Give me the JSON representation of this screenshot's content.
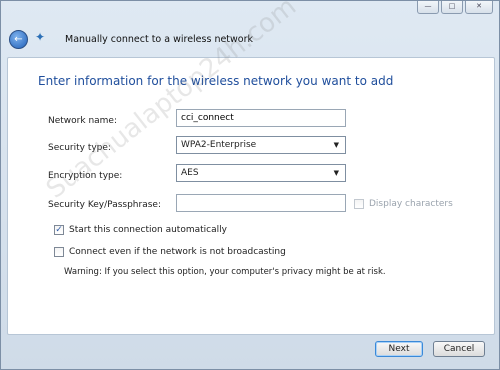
{
  "window": {
    "title": "Manually connect to a wireless network",
    "controls": {
      "minimize": "—",
      "maximize": "□",
      "close": "✕"
    }
  },
  "heading": "Enter information for the wireless network you want to add",
  "form": {
    "network_name": {
      "label": "Network name:",
      "value": "cci_connect"
    },
    "security_type": {
      "label": "Security type:",
      "value": "WPA2-Enterprise"
    },
    "encryption_type": {
      "label": "Encryption type:",
      "value": "AES"
    },
    "security_key": {
      "label": "Security Key/Passphrase:",
      "value": "",
      "display_characters": "Display characters"
    }
  },
  "options": {
    "start_auto": "Start this connection automatically",
    "connect_not_broadcasting": "Connect even if the network is not broadcasting",
    "warning": "Warning: If you select this option, your computer's privacy might be at risk."
  },
  "buttons": {
    "next": "Next",
    "cancel": "Cancel"
  },
  "watermark": "Suachualaptop24h.com",
  "icons": {
    "back": "back-arrow-icon",
    "wizard": "wireless-network-icon",
    "caret": "dropdown-arrow-icon"
  }
}
